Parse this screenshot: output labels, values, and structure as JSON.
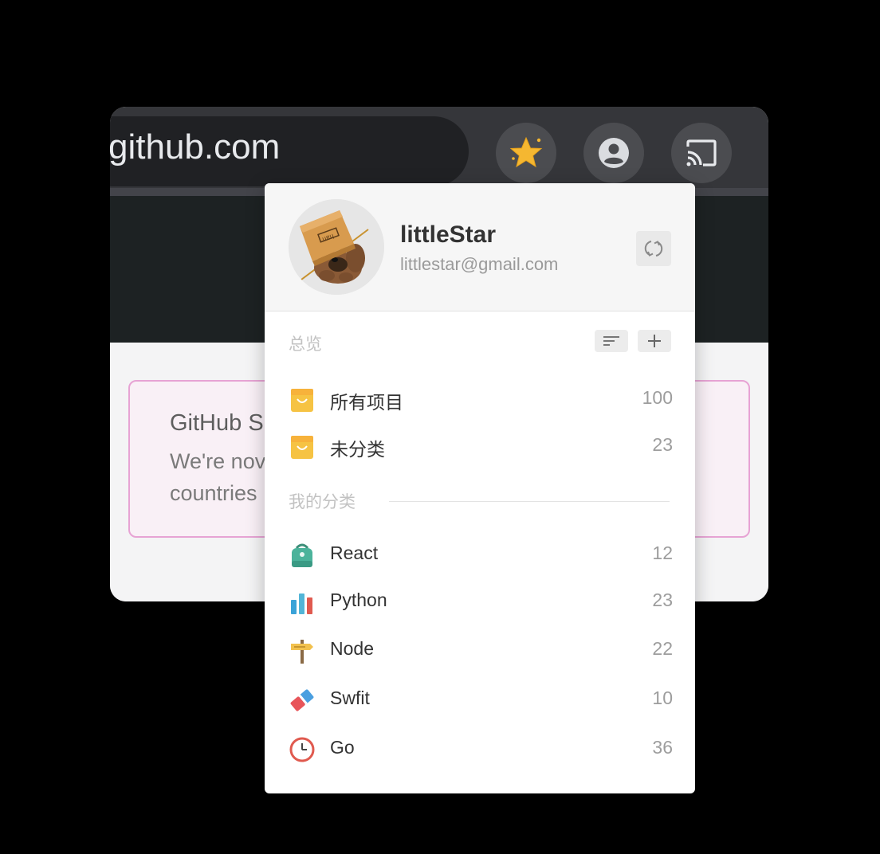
{
  "browser": {
    "url": "github.com",
    "toolbar_buttons": [
      "star-extension-icon",
      "profile-icon",
      "cast-icon"
    ],
    "banner": {
      "title": "GitHub S",
      "line1": "We're nov",
      "line2": "countries"
    }
  },
  "popup": {
    "user": {
      "name": "littleStar",
      "email": "littlestar@gmail.com"
    },
    "overview_label": "总览",
    "overview_items": [
      {
        "label": "所有项目",
        "count": "100",
        "icon": "shopping-bag-icon"
      },
      {
        "label": "未分类",
        "count": "23",
        "icon": "shopping-bag-icon"
      }
    ],
    "my_categories_label": "我的分类",
    "categories": [
      {
        "label": "React",
        "count": "12",
        "icon": "backpack-icon"
      },
      {
        "label": "Python",
        "count": "23",
        "icon": "bar-chart-icon"
      },
      {
        "label": "Node",
        "count": "22",
        "icon": "signpost-icon"
      },
      {
        "label": "Swfit",
        "count": "10",
        "icon": "eraser-icon"
      },
      {
        "label": "Go",
        "count": "36",
        "icon": "clock-icon"
      }
    ]
  },
  "colors": {
    "popup_bg": "#ffffff",
    "toolbar": "#35363a",
    "banner_border": "#e7a3d4"
  }
}
